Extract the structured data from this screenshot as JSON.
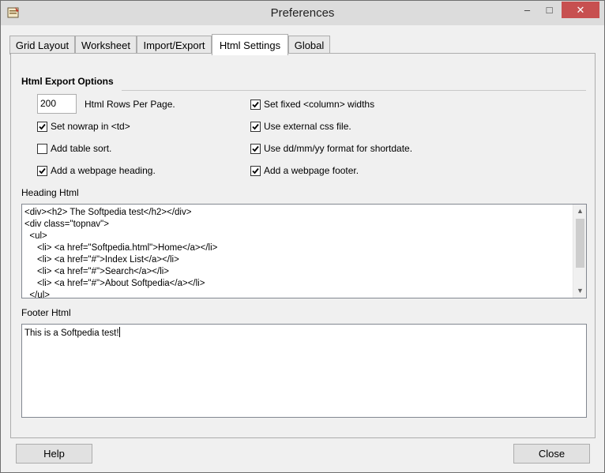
{
  "window": {
    "title": "Preferences"
  },
  "tabs": [
    "Grid Layout",
    "Worksheet",
    "Import/Export",
    "Html Settings",
    "Global"
  ],
  "active_tab": "Html Settings",
  "section": {
    "title": "Html Export Options"
  },
  "rows_per_page": {
    "value": "200",
    "label": "Html Rows Per Page."
  },
  "options_left": [
    {
      "label": "Set nowrap in <td>",
      "checked": true
    },
    {
      "label": "Add table sort.",
      "checked": false
    },
    {
      "label": "Add a webpage heading.",
      "checked": true
    }
  ],
  "options_right": [
    {
      "label": "Set fixed <column> widths",
      "checked": true
    },
    {
      "label": "Use external css file.",
      "checked": true
    },
    {
      "label": "Use dd/mm/yy format for shortdate.",
      "checked": true
    },
    {
      "label": "Add a webpage footer.",
      "checked": true
    }
  ],
  "heading_html": {
    "label": "Heading Html",
    "lines": [
      "<div><h2> The Softpedia test</h2></div>",
      "<div class=\"topnav\">",
      "  <ul>",
      "     <li> <a href=\"Softpedia.html\">Home</a></li>",
      "     <li> <a href=\"#\">Index List</a></li>",
      "     <li> <a href=\"#\">Search</a></li>",
      "     <li> <a href=\"#\">About Softpedia</a></li>",
      "  </ul>"
    ]
  },
  "footer_html": {
    "label": "Footer Html",
    "value": "This is a Softpedia test!"
  },
  "buttons": {
    "help": "Help",
    "close": "Close"
  },
  "window_controls": {
    "minimize": "–",
    "maximize": "□",
    "close": "✕"
  }
}
